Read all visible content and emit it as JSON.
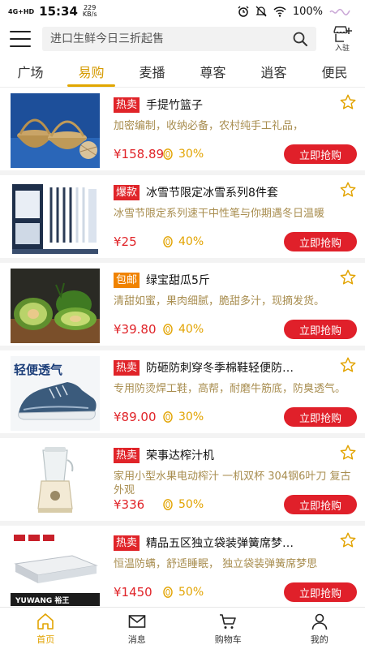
{
  "status_bar": {
    "signal": "4G+HD",
    "time": "15:34",
    "speed_value": "229",
    "speed_unit": "KB/s",
    "battery": "100%"
  },
  "header": {
    "search_placeholder": "进口生鲜今日三折起售",
    "join_label": "入驻"
  },
  "tabs": [
    {
      "label": "广场",
      "active": false
    },
    {
      "label": "易购",
      "active": true
    },
    {
      "label": "麦播",
      "active": false
    },
    {
      "label": "尊客",
      "active": false
    },
    {
      "label": "逍客",
      "active": false
    },
    {
      "label": "便民",
      "active": false
    }
  ],
  "products": [
    {
      "badge": "热卖",
      "badge_color": "#e02429",
      "title": "手提竹篮子",
      "desc": "加密编制，收纳必备，农村纯手工礼品，",
      "price": "¥158.89",
      "percent": "30%",
      "buy_label": "立即抢购",
      "image": "bamboo-basket"
    },
    {
      "badge": "爆款",
      "badge_color": "#e02429",
      "title": "冰雪节限定冰雪系列8件套",
      "desc": "冰雪节限定系列速干中性笔与你期遇冬日温暖",
      "price": "¥25",
      "percent": "40%",
      "buy_label": "立即抢购",
      "image": "pen-set"
    },
    {
      "badge": "包邮",
      "badge_color": "#f08300",
      "title": "绿宝甜瓜5斤",
      "desc": "清甜如蜜，果肉细腻，脆甜多汁，现摘发货。",
      "price": "¥39.80",
      "percent": "40%",
      "buy_label": "立即抢购",
      "image": "melon"
    },
    {
      "badge": "热卖",
      "badge_color": "#e02429",
      "title": "防砸防刺穿冬季棉鞋轻便防…",
      "desc": "专用防烫焊工鞋，高帮，耐磨牛筋底，防臭透气。",
      "price": "¥89.00",
      "percent": "30%",
      "buy_label": "立即抢购",
      "image": "shoe",
      "image_text": "轻便透气"
    },
    {
      "badge": "热卖",
      "badge_color": "#e02429",
      "title": "荣事达榨汁机",
      "desc": "家用小型水果电动榨汁 一机双杯 304钢6叶刀 复古外观",
      "price": "¥336",
      "percent": "50%",
      "buy_label": "立即抢购",
      "image": "juicer"
    },
    {
      "badge": "热卖",
      "badge_color": "#e02429",
      "title": "精品五区独立袋装弹簧席梦…",
      "desc": "恒温防螨，舒适睡眠， 独立袋装弹簧席梦思",
      "price": "¥1450",
      "percent": "50%",
      "buy_label": "立即抢购",
      "image": "mattress",
      "image_text": "YUWANG 裕王"
    }
  ],
  "bottom_nav": [
    {
      "label": "首页",
      "icon": "home-icon",
      "active": true
    },
    {
      "label": "消息",
      "icon": "mail-icon",
      "active": false
    },
    {
      "label": "购物车",
      "icon": "cart-icon",
      "active": false
    },
    {
      "label": "我的",
      "icon": "user-icon",
      "active": false
    }
  ],
  "colors": {
    "accent": "#e2a300",
    "price_red": "#e02429",
    "desc_brown": "#a88d4f"
  }
}
